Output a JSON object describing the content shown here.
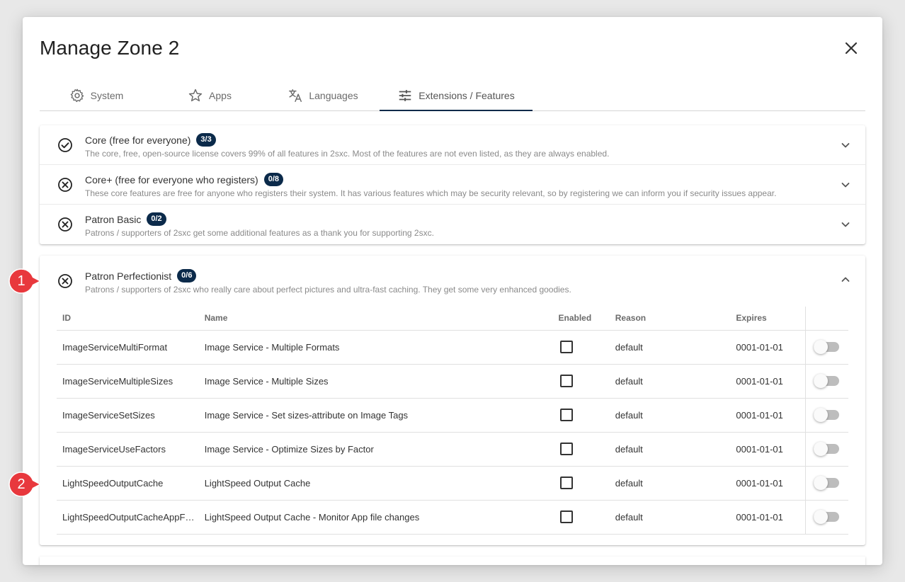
{
  "dialog": {
    "title": "Manage Zone 2"
  },
  "tabs": [
    {
      "label": "System",
      "icon": "gear-icon"
    },
    {
      "label": "Apps",
      "icon": "star-icon"
    },
    {
      "label": "Languages",
      "icon": "translate-icon"
    },
    {
      "label": "Extensions / Features",
      "icon": "tune-icon",
      "active": true
    }
  ],
  "panels": [
    {
      "title": "Core (free for everyone)",
      "badge": "3/3",
      "status_icon": "check-circle-icon",
      "description": "The core, free, open-source license covers 99% of all features in 2sxc. Most of the features are not even listed, as they are always enabled."
    },
    {
      "title": "Core+ (free for everyone who registers)",
      "badge": "0/8",
      "status_icon": "x-circle-icon",
      "description": "These core features are free for anyone who registers their system. It has various features which may be security relevant, so by registering we can inform you if security issues appear."
    },
    {
      "title": "Patron Basic",
      "badge": "0/2",
      "status_icon": "x-circle-icon",
      "description": "Patrons / supporters of 2sxc get some additional features as a thank you for supporting 2sxc."
    }
  ],
  "expanded_panel": {
    "title": "Patron Perfectionist",
    "badge": "0/6",
    "status_icon": "x-circle-icon",
    "description": "Patrons / supporters of 2sxc who really care about perfect pictures and ultra-fast caching. They get some very enhanced goodies.",
    "columns": {
      "id": "ID",
      "name": "Name",
      "enabled": "Enabled",
      "reason": "Reason",
      "expires": "Expires"
    },
    "rows": [
      {
        "id": "ImageServiceMultiFormat",
        "name": "Image Service - Multiple Formats",
        "reason": "default",
        "expires": "0001-01-01"
      },
      {
        "id": "ImageServiceMultipleSizes",
        "name": "Image Service - Multiple Sizes",
        "reason": "default",
        "expires": "0001-01-01"
      },
      {
        "id": "ImageServiceSetSizes",
        "name": "Image Service - Set sizes-attribute on Image Tags",
        "reason": "default",
        "expires": "0001-01-01"
      },
      {
        "id": "ImageServiceUseFactors",
        "name": "Image Service - Optimize Sizes by Factor",
        "reason": "default",
        "expires": "0001-01-01"
      },
      {
        "id": "LightSpeedOutputCache",
        "name": "LightSpeed Output Cache",
        "reason": "default",
        "expires": "0001-01-01"
      },
      {
        "id": "LightSpeedOutputCacheAppF…",
        "name": "LightSpeed Output Cache - Monitor App file changes",
        "reason": "default",
        "expires": "0001-01-01"
      }
    ]
  },
  "annotations": {
    "marker_1": "1",
    "marker_2": "2",
    "color": "#e8383d"
  },
  "colors": {
    "accent": "#0b2a4a",
    "toggle_track": "#bdbdbd"
  }
}
